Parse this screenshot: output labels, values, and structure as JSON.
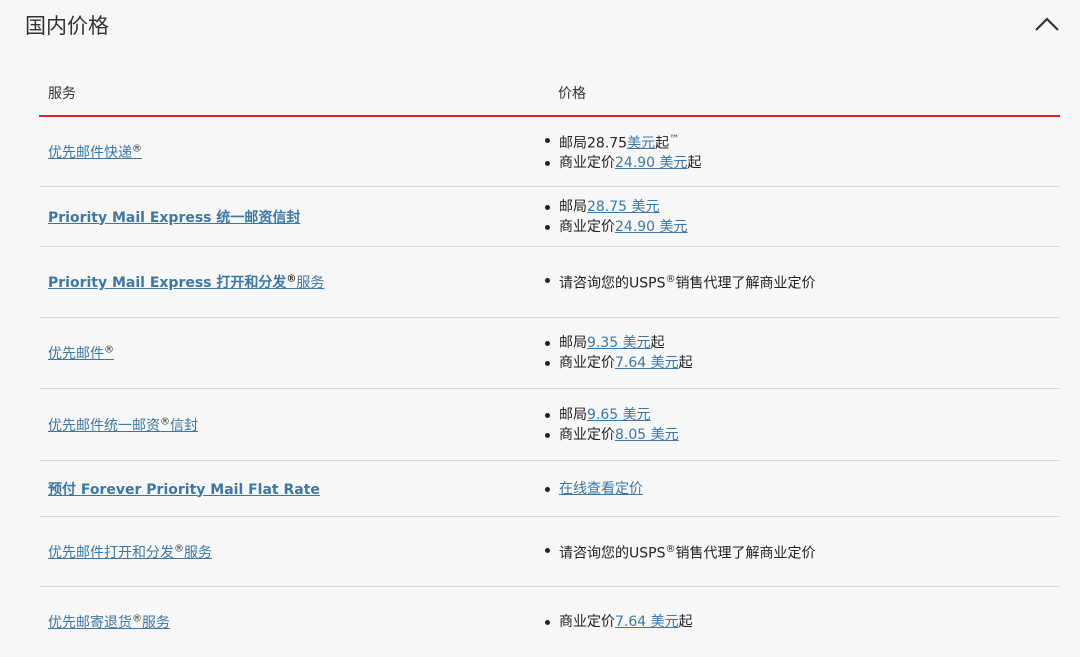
{
  "header": {
    "title": "国内价格"
  },
  "table": {
    "col_service": "服务",
    "col_price": "价格",
    "rows": [
      {
        "service": "优先邮件快递",
        "sup": "®",
        "prices": [
          {
            "pre": "邮局28.75",
            "link": "美元",
            "post": "起",
            "sup": "™"
          },
          {
            "pre": "商业定价",
            "link": "24.90 美元",
            "post": "起"
          }
        ]
      },
      {
        "service": "Priority Mail Express 统一邮资信封",
        "prices": [
          {
            "pre": "邮局",
            "link": "28.75 美元",
            "post": ""
          },
          {
            "pre": "商业定价",
            "link": "24.90 美元",
            "post": ""
          }
        ]
      },
      {
        "service": "Priority Mail Express 打开和分发",
        "sup": "®",
        "service_tail": "服务",
        "prices": [
          {
            "pre": "请咨询您的USPS",
            "sup": "®",
            "post": "销售代理了解商业定价"
          }
        ]
      },
      {
        "service": "优先邮件",
        "sup": "®",
        "prices": [
          {
            "pre": "邮局",
            "link": "9.35 美元",
            "post": "起"
          },
          {
            "pre": "商业定价",
            "link": "7.64 美元",
            "post": "起"
          }
        ]
      },
      {
        "service": "优先邮件统一邮资",
        "sup": "®",
        "service_tail": "信封",
        "prices": [
          {
            "pre": "邮局",
            "link": "9.65 美元",
            "post": ""
          },
          {
            "pre": "商业定价",
            "link": "8.05 美元",
            "post": ""
          }
        ]
      },
      {
        "service": "预付 Forever Priority Mail Flat Rate",
        "prices": [
          {
            "pre": "",
            "link": "在线查看定价",
            "post": ""
          }
        ]
      },
      {
        "service": "优先邮件打开和分发",
        "sup": "®",
        "service_tail": "服务",
        "prices": [
          {
            "pre": "请咨询您的USPS",
            "sup": "®",
            "post": "销售代理了解商业定价"
          }
        ]
      },
      {
        "service": "优先邮寄退货",
        "sup": "®",
        "service_tail": "服务",
        "prices": [
          {
            "pre": "商业定价",
            "link": "7.64 美元",
            "post": "起"
          }
        ]
      }
    ]
  },
  "icons": {
    "collapse": "chevron-up-icon"
  }
}
